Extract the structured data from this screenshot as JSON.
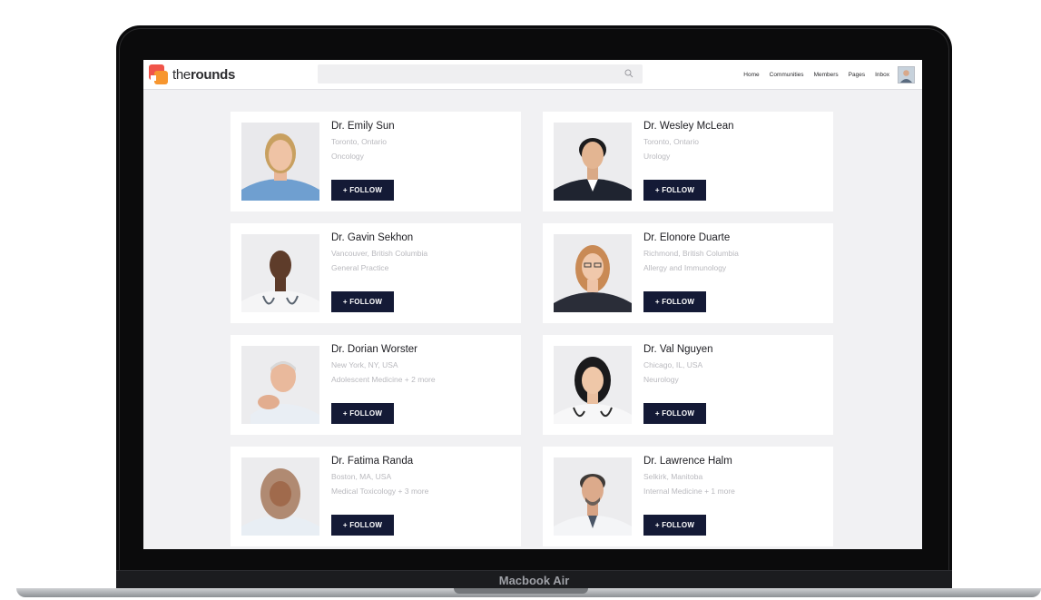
{
  "device": {
    "model_label": "Macbook Air"
  },
  "app": {
    "logo": {
      "prefix": "the",
      "bold": "rounds"
    },
    "search": {
      "placeholder": "",
      "icon": "search-icon"
    },
    "nav": [
      "Home",
      "Communities",
      "Members",
      "Pages",
      "Inbox"
    ]
  },
  "colors": {
    "follow_button": "#141a36",
    "logo_red": "#f0544a",
    "logo_orange": "#f7962f"
  },
  "follow_label": "+ FOLLOW",
  "doctors": [
    {
      "name": "Dr. Emily Sun",
      "location": "Toronto, Ontario",
      "specialty": "Oncology"
    },
    {
      "name": "Dr. Wesley McLean",
      "location": "Toronto, Ontario",
      "specialty": "Urology"
    },
    {
      "name": "Dr. Gavin Sekhon",
      "location": "Vancouver, British Columbia",
      "specialty": "General Practice"
    },
    {
      "name": "Dr. Elonore Duarte",
      "location": "Richmond, British Columbia",
      "specialty": "Allergy and Immunology"
    },
    {
      "name": "Dr. Dorian Worster",
      "location": "New York, NY, USA",
      "specialty": "Adolescent Medicine + 2 more"
    },
    {
      "name": "Dr. Val Nguyen",
      "location": "Chicago, IL, USA",
      "specialty": "Neurology"
    },
    {
      "name": "Dr. Fatima Randa",
      "location": "Boston, MA, USA",
      "specialty": "Medical Toxicology + 3 more"
    },
    {
      "name": "Dr. Lawrence Halm",
      "location": "Selkirk, Manitoba",
      "specialty": "Internal Medicine + 1 more"
    }
  ]
}
